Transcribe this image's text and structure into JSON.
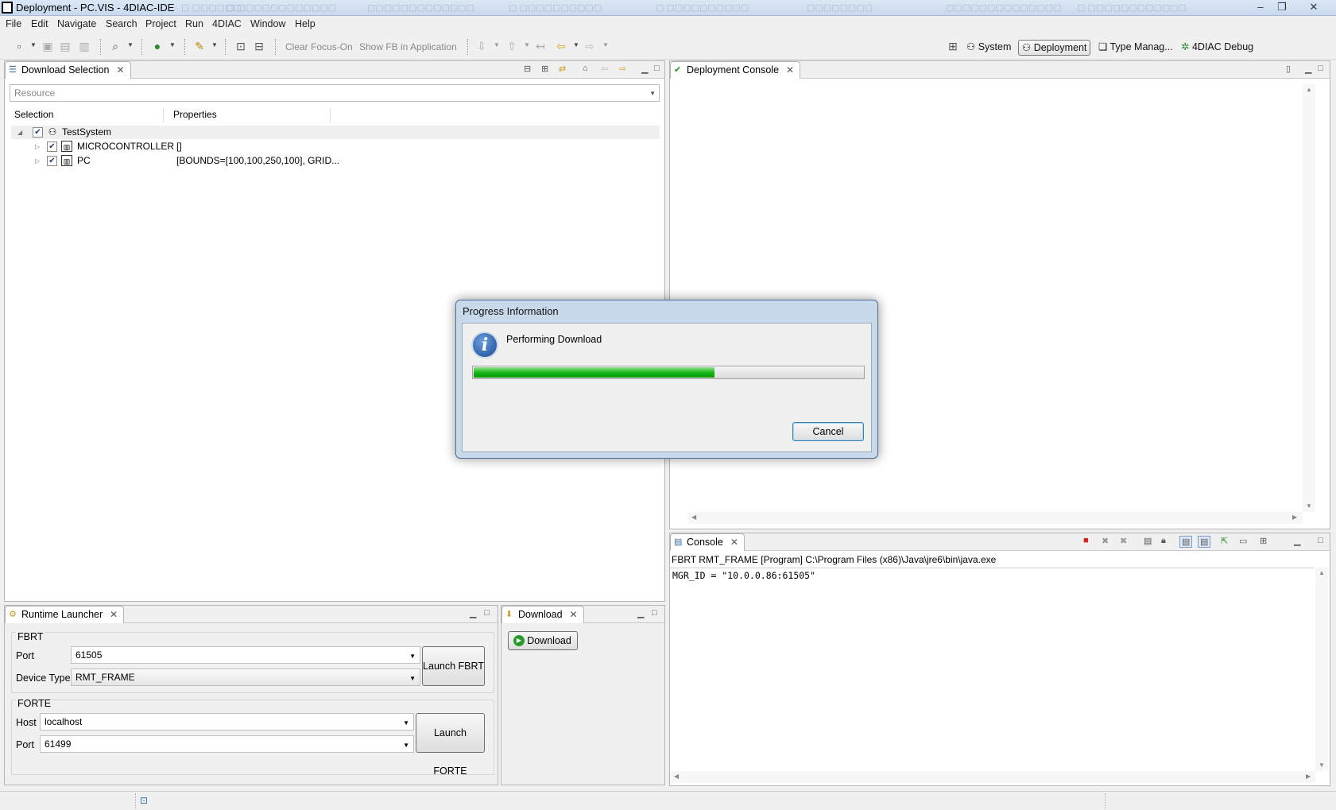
{
  "window": {
    "title": "Deployment - PC.VIS - 4DIAC-IDE",
    "controls": [
      "minimize",
      "maximize",
      "close"
    ]
  },
  "menubar": [
    "File",
    "Edit",
    "Navigate",
    "Search",
    "Project",
    "Run",
    "4DIAC",
    "Window",
    "Help"
  ],
  "toolbar": {
    "clear_focus": "Clear Focus-On",
    "show_fb": "Show FB in Application",
    "perspectives": [
      "System",
      "Deployment",
      "Type Manag...",
      "4DIAC Debug"
    ],
    "active_perspective": "Deployment"
  },
  "download_selection": {
    "tab_label": "Download Selection",
    "filter_value": "Resource",
    "columns": [
      "Selection",
      "Properties"
    ],
    "rows": [
      {
        "name": "TestSystem",
        "properties": "",
        "checked": true,
        "level": 0
      },
      {
        "name": "MICROCONTROLLER",
        "properties": "[]",
        "checked": true,
        "level": 1
      },
      {
        "name": "PC",
        "properties": "[BOUNDS=[100,100,250,100], GRID...",
        "checked": true,
        "level": 1
      }
    ]
  },
  "deployment_console": {
    "tab_label": "Deployment Console"
  },
  "console": {
    "tab_label": "Console",
    "header": "FBRT RMT_FRAME [Program] C:\\Program Files (x86)\\Java\\jre6\\bin\\java.exe",
    "lines": [
      "MGR_ID = \"10.0.0.86:61505\""
    ]
  },
  "runtime_launcher": {
    "tab_label": "Runtime Launcher",
    "fbrt": {
      "group_label": "FBRT",
      "port_label": "Port",
      "port_value": "61505",
      "device_type_label": "Device Type",
      "device_type_value": "RMT_FRAME",
      "launch_label": "Launch FBRT"
    },
    "forte": {
      "group_label": "FORTE",
      "host_label": "Host",
      "host_value": "localhost",
      "port_label": "Port",
      "port_value": "61499",
      "launch_label": "Launch FORTE"
    }
  },
  "download_panel": {
    "tab_label": "Download",
    "button_label": "Download"
  },
  "progress_dialog": {
    "title": "Progress Information",
    "message": "Performing Download",
    "progress_fraction": 0.62,
    "cancel_label": "Cancel"
  },
  "colors": {
    "progress_green": "#12b312",
    "accent_blue": "#3a6ea5"
  }
}
